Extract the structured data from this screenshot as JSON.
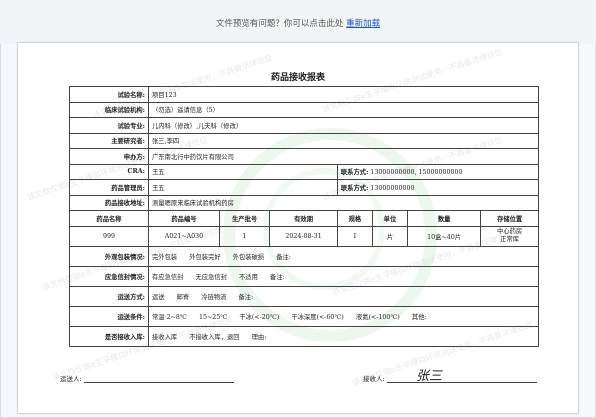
{
  "notice": {
    "text": "文件预览有问题？你可以点击此处",
    "link": "重新加载"
  },
  "watermark": "该文档仅做e生平模拟环境测试使用，不具备法律效应",
  "title": "药品接收报表",
  "fields": [
    {
      "label": "试验名称:",
      "value": "项目123"
    },
    {
      "label": "临床试验机构:",
      "value": "（勿选）遥请信息（5）"
    },
    {
      "label": "试验专业:",
      "value": "儿内科（修改）,儿夫科（修改）"
    },
    {
      "label": "主要研究者:",
      "value": "张三,李四"
    },
    {
      "label": "申办方:",
      "value": "广东南北行中药饮片有限公司"
    }
  ],
  "cra": {
    "label": "CRA:",
    "value": "王五",
    "contact_label": "联系方式:",
    "contact_value": "13000000000, 15000000000"
  },
  "manager": {
    "label": "药品管理员:",
    "value": "王五",
    "contact_label": "联系方式:",
    "contact_value": "13000000000"
  },
  "address": {
    "label": "药品接收地址:",
    "value": "测量嗯原来临床试验机构药房"
  },
  "drug_headers": [
    "药品名称",
    "药品编号",
    "生产批号",
    "有效期",
    "规格",
    "单位",
    "数量",
    "存储位置"
  ],
  "drug_row": [
    "999",
    "A021~A030",
    "1",
    "2024-08-31",
    "1",
    "片",
    "10盒~40片",
    "中心药房\n正常库"
  ],
  "checks": [
    {
      "label": "外观包装情况:",
      "options": [
        "完外包装",
        "外包装完好",
        "外包装破损",
        "备注:"
      ]
    },
    {
      "label": "应急信封情况:",
      "options": [
        "有应急信封",
        "无应急信封",
        "不适用",
        "备注:"
      ]
    },
    {
      "label": "运送方式:",
      "options": [
        "运送",
        "邮寄",
        "冷链物流",
        "备注:"
      ]
    },
    {
      "label": "运送条件:",
      "options": [
        "常温 2~8℃",
        "15~25℃",
        "干冰(<-20℃)",
        "干冰深度(<-60℃)",
        "液氮(<-100℃)",
        "其他:"
      ]
    },
    {
      "label": "是否接收入库:",
      "options": [
        "接收入库",
        "不接收入库，退回",
        "理由:"
      ]
    }
  ],
  "footer": {
    "sender_label": "运送人:",
    "receiver_label": "接收人:",
    "receiver_signature": "张三"
  }
}
